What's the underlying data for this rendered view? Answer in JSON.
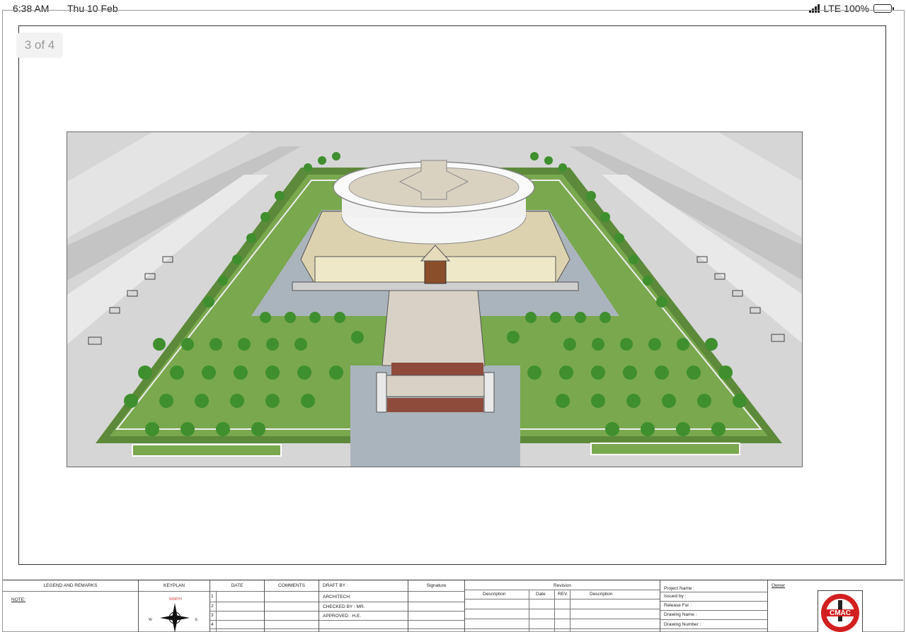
{
  "status_bar": {
    "time": "6:38 AM",
    "date": "Thu 10 Feb",
    "network": "LTE",
    "battery": "100%"
  },
  "viewer": {
    "page_indicator": "3 of 4"
  },
  "title_block": {
    "legend_header": "LEGEND AND REMARKS",
    "note_label": "NOTE:",
    "keyplan_header": "KEYPLAN",
    "compass_north": "NORTH",
    "compass_west": "W",
    "compass_east": "E",
    "date_header": "DATE",
    "comments_header": "COMMENTS",
    "row_numbers": [
      "1",
      "2",
      "3",
      "4"
    ],
    "draft_by": "DRAFT BY :",
    "architect": "ARCHITECH:",
    "checked_by": "CHECKED BY : MR.",
    "approved": "APPROVED : H.E.",
    "signature_header": "Signature",
    "revision_header": "Revision",
    "rev_description": "Description",
    "rev_date": "Date",
    "rev_rev": "REV.",
    "rev_description2": "Description",
    "project_name": "Project Name :",
    "issued_by": "Issued by :",
    "release_for": "Release For :",
    "drawing_name": "Drawing Name :",
    "drawing_number": "Drawing Number :",
    "owner_label": "Owner",
    "logo_text": "CMAC"
  },
  "colors": {
    "grass": "#6f9e45",
    "paving": "#a9b2ba",
    "road": "#cfcfcf",
    "tree": "#3f8f2e",
    "logo_red": "#d21f1f"
  }
}
